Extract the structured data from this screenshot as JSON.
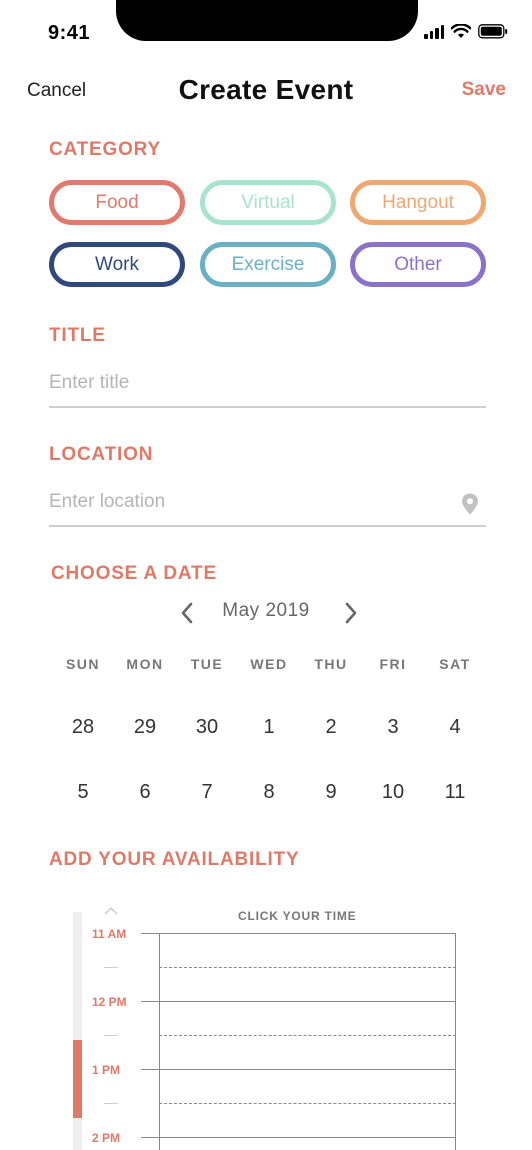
{
  "status": {
    "time": "9:41"
  },
  "nav": {
    "cancel": "Cancel",
    "title": "Create Event",
    "save": "Save"
  },
  "category": {
    "label": "CATEGORY",
    "options": [
      {
        "label": "Food",
        "color": "#e07a6f"
      },
      {
        "label": "Virtual",
        "color": "#a8e4cd"
      },
      {
        "label": "Hangout",
        "color": "#f0a873"
      },
      {
        "label": "Work",
        "color": "#2f4a7a"
      },
      {
        "label": "Exercise",
        "color": "#6ab0c4"
      },
      {
        "label": "Other",
        "color": "#8b72c9"
      }
    ]
  },
  "title_field": {
    "label": "TITLE",
    "placeholder": "Enter title",
    "value": ""
  },
  "location_field": {
    "label": "LOCATION",
    "placeholder": "Enter location",
    "value": "",
    "icon": "map-pin-icon"
  },
  "date": {
    "label": "CHOOSE A DATE",
    "month": "May 2019",
    "weekdays": [
      "SUN",
      "MON",
      "TUE",
      "WED",
      "THU",
      "FRI",
      "SAT"
    ],
    "weeks": [
      [
        "28",
        "29",
        "30",
        "1",
        "2",
        "3",
        "4"
      ],
      [
        "5",
        "6",
        "7",
        "8",
        "9",
        "10",
        "11"
      ]
    ]
  },
  "availability": {
    "label": "ADD YOUR AVAILABILITY",
    "hint": "CLICK YOUR TIME",
    "times": [
      "11 AM",
      "12 PM",
      "1 PM",
      "2 PM"
    ]
  },
  "colors": {
    "accent": "#e07a68"
  }
}
